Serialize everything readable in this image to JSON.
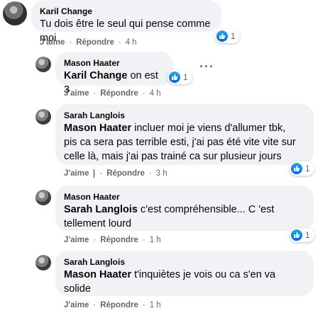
{
  "comments": [
    {
      "author": "Karil Change",
      "text": "Tu dois être le seul qui pense comme moi",
      "reaction_count": "1",
      "like": "J'aime",
      "reply": "Répondre",
      "time": "4 h"
    },
    {
      "author": "Mason Haater",
      "mention": "Karil Change",
      "text": " on est 3",
      "reaction_count": "1",
      "like": "J'aime",
      "reply": "Répondre",
      "time": "4 h"
    },
    {
      "author": "Sarah Langlois",
      "mention": "Mason Haater",
      "text_line1": " incluer moi je viens d'allumer tbk,",
      "text_line2": "pis ca sera pas terrible esti, j'ai pas été vite vite sur",
      "text_line3": "celle là, mais j'ai pas trainé ca sur plusieur jours",
      "reaction_count": "1",
      "like": "J'aime",
      "reply": "Répondre",
      "time": "3 h"
    },
    {
      "author": "Mason Haater",
      "mention": "Sarah Langlois",
      "text_line1": " c'est compréhensible... C 'est",
      "text_line2": "tellement lourd",
      "reaction_count": "1",
      "like": "J'aime",
      "reply": "Répondre",
      "time": "1 h"
    },
    {
      "author": "Sarah Langlois",
      "mention": "Mason Haater",
      "text_line1": " t'inquiètes je vois ou ca s'en va",
      "text_line2": "solide",
      "like": "J'aime",
      "reply": "Répondre",
      "time": "1 h"
    }
  ],
  "separator": "·",
  "icons": {
    "like": "thumbs-up-icon",
    "more": "more-options-icon"
  },
  "colors": {
    "bubble": "#f0f2f5",
    "like_blue": "#1877f2",
    "meta_gray": "#65676b"
  }
}
